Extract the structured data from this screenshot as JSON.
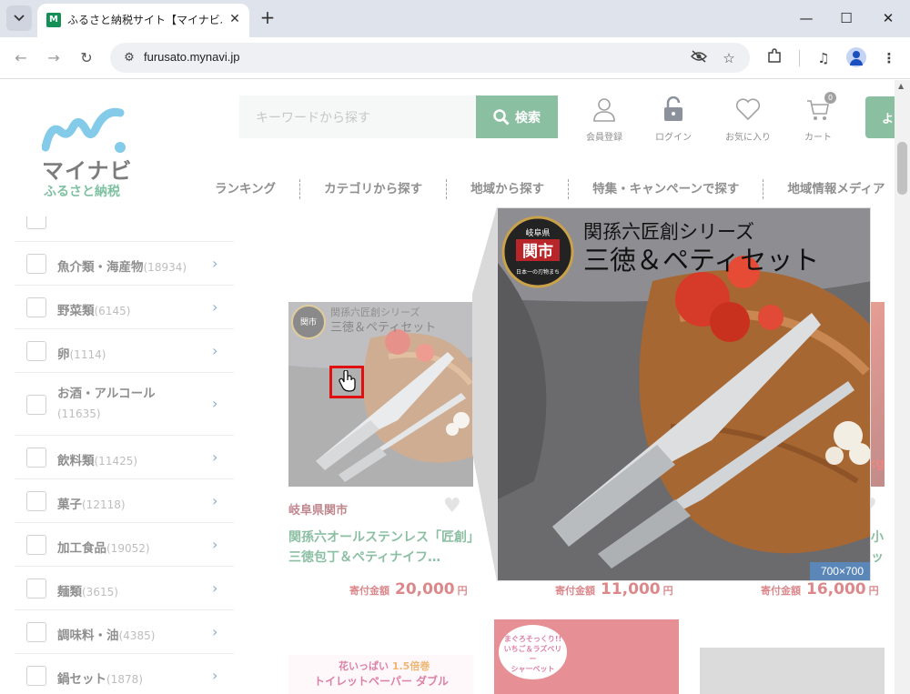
{
  "browser": {
    "tab_title": "ふるさと納税サイト【マイナビふるさと納税】",
    "url": "furusato.mynavi.jp",
    "favicon": "M"
  },
  "header": {
    "logo_line1": "マイナビ",
    "logo_line2": "ふるさと納税",
    "search_placeholder": "キーワードから探す",
    "search_button": "検索",
    "member": "会員登録",
    "login": "ログイン",
    "favorites": "お気に入り",
    "cart": "カート",
    "cart_count": "0",
    "edge_button": "よ"
  },
  "global_nav": [
    "ランキング",
    "カテゴリから探す",
    "地域から探す",
    "特集・キャンペーンで探す",
    "地域情報メディア"
  ],
  "categories": [
    {
      "name": "魚介類・海産物",
      "count": "(18934)"
    },
    {
      "name": "野菜類",
      "count": "(6145)"
    },
    {
      "name": "卵",
      "count": "(1114)"
    },
    {
      "name": "お酒・アルコール",
      "count": "(11635)"
    },
    {
      "name": "飲料類",
      "count": "(11425)"
    },
    {
      "name": "菓子",
      "count": "(12118)"
    },
    {
      "name": "加工食品",
      "count": "(19052)"
    },
    {
      "name": "麺類",
      "count": "(3615)"
    },
    {
      "name": "調味料・油",
      "count": "(4385)"
    },
    {
      "name": "鍋セット",
      "count": "(1878)"
    }
  ],
  "products": [
    {
      "location": "岐阜県関市",
      "title": "関孫六オールステンレス「匠創」三徳包丁＆ペティナイフ…",
      "price_label": "寄付金額",
      "amount": "20,000",
      "unit": "円",
      "banner_series": "関孫六匠創シリーズ",
      "banner_main": "三徳＆ペティセット",
      "badge_pref": "岐阜県",
      "badge_city": "関市"
    },
    {
      "price_label": "寄付金額",
      "amount": "11,000",
      "unit": "円"
    },
    {
      "title_frag": "小",
      "frag2": "ッ",
      "price_label": "寄付金額",
      "amount": "16,000",
      "unit": "円",
      "tag": "kg"
    }
  ],
  "row2": {
    "banner1_line1": "花いっぱい",
    "banner1_big": "1.5倍巻",
    "banner1_line2": "トイレットペーパー ダブル",
    "banner2_line1": "まぐろそっくり!!",
    "banner2_line2": "いちご＆ラズベリー",
    "banner2_line3": "シャーベット"
  },
  "zoom": {
    "series": "関孫六匠創シリーズ",
    "main": "三徳＆ペティセット",
    "badge_pref": "岐阜県",
    "badge_city": "関市",
    "badge_sub": "日本一の刃物まち",
    "size_label": "700×700"
  }
}
